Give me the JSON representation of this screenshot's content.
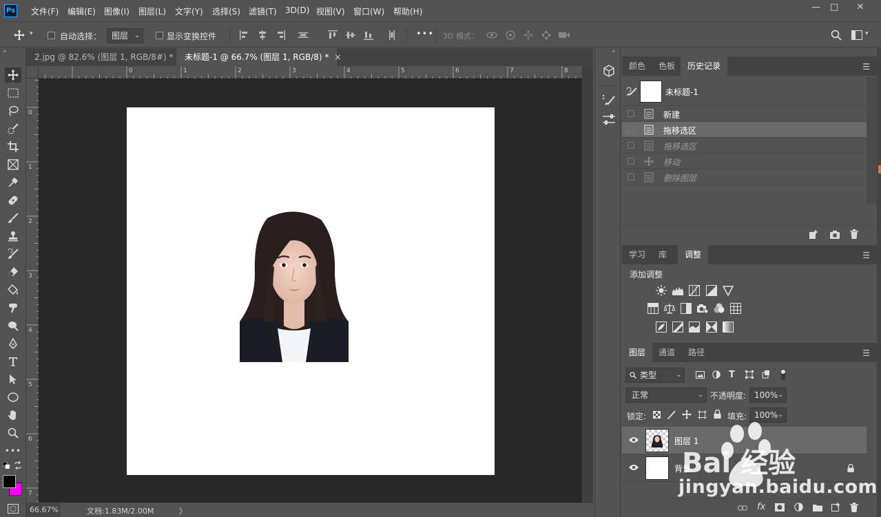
{
  "app": {
    "logo": "Ps"
  },
  "menu": [
    "文件(F)",
    "编辑(E)",
    "图像(I)",
    "图层(L)",
    "文字(Y)",
    "选择(S)",
    "滤镜(T)",
    "3D(D)",
    "视图(V)",
    "窗口(W)",
    "帮助(H)"
  ],
  "window_controls": {
    "minimize": "—",
    "maximize": "□",
    "close": "✕"
  },
  "options": {
    "auto_select_label": "自动选择：",
    "auto_select_target": "图层",
    "show_transform_label": "显示变换控件",
    "more": "•••",
    "mode_3d_label": "3D 模式："
  },
  "tabs": [
    {
      "label": "2.jpg @ 82.6% (图层 1, RGB/8#) *",
      "close": "×"
    },
    {
      "label": "未标题-1 @ 66.7% (图层 1, RGB/8) *",
      "close": "×"
    }
  ],
  "ruler": {
    "h": [
      "0",
      "1",
      "2",
      "3",
      "4",
      "5",
      "6",
      "7",
      "8"
    ],
    "v": [
      "0",
      "1",
      "2",
      "3",
      "4",
      "5",
      "6",
      "7"
    ]
  },
  "status": {
    "zoom": "66.67%",
    "doc": "文档:1.83M/2.00M",
    "arrow": "〉"
  },
  "colors": {
    "foreground": "#000000",
    "background": "#ff00ff"
  },
  "history_panel": {
    "tabs": [
      "颜色",
      "色板",
      "历史记录"
    ],
    "snapshot_name": "未标题-1",
    "items": [
      {
        "label": "新建",
        "state": "done"
      },
      {
        "label": "拖移选区",
        "state": "selected"
      },
      {
        "label": "拖移选区",
        "state": "undone"
      },
      {
        "label": "移动",
        "state": "undone"
      },
      {
        "label": "删除图层",
        "state": "undone"
      }
    ]
  },
  "adjust_panel": {
    "tabs": [
      "学习",
      "库",
      "调整"
    ],
    "title": "添加调整"
  },
  "layers_panel": {
    "tabs": [
      "图层",
      "通道",
      "路径"
    ],
    "filter_label": "类型",
    "blend_mode": "正常",
    "opacity_label": "不透明度:",
    "opacity_value": "100%",
    "lock_label": "锁定:",
    "fill_label": "填充:",
    "fill_value": "100%",
    "layers": [
      {
        "name": "图层 1",
        "selected": true
      },
      {
        "name": "背景",
        "selected": false,
        "locked": true
      }
    ],
    "footer_fx": "fx"
  },
  "watermark": {
    "brand": "Bai 经验",
    "url": "jingyan.baidu.com"
  }
}
